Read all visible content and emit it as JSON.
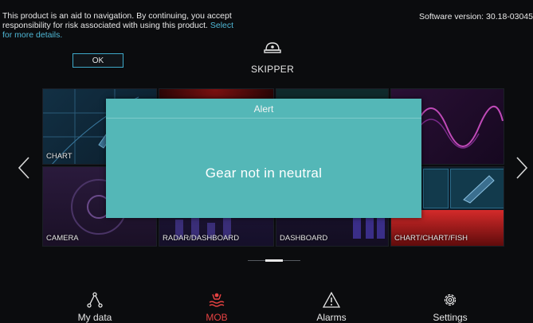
{
  "disclaimer": {
    "text": "This product is an aid to navigation. By continuing, you accept responsibility for risk associated with using this product.",
    "link": "Select for more details."
  },
  "ok_button": {
    "label": "OK"
  },
  "software_version": "Software version: 30.18-03045",
  "profile": {
    "icon": "captain-hat-icon",
    "name": "SKIPPER"
  },
  "tiles": [
    {
      "label": "CHART"
    },
    {
      "label": ""
    },
    {
      "label": ""
    },
    {
      "label": ""
    },
    {
      "label": "CAMERA"
    },
    {
      "label": "RADAR/DASHBOARD"
    },
    {
      "label": "DASHBOARD"
    },
    {
      "label": "CHART/CHART/FISH"
    }
  ],
  "alert": {
    "title": "Alert",
    "message": "Gear not in neutral"
  },
  "nav": {
    "prev_icon": "chevron-left-icon",
    "next_icon": "chevron-right-icon"
  },
  "page_indicator": {
    "current": 2,
    "total": 3
  },
  "bottom_bar": [
    {
      "label": "My data",
      "icon": "route-nodes-icon"
    },
    {
      "label": "MOB",
      "icon": "man-overboard-icon"
    },
    {
      "label": "Alarms",
      "icon": "warning-triangle-icon"
    },
    {
      "label": "Settings",
      "icon": "gear-icon"
    }
  ],
  "colors": {
    "accent": "#3ea9c9",
    "dialog": "#54b7b7",
    "mob": "#e64242"
  }
}
